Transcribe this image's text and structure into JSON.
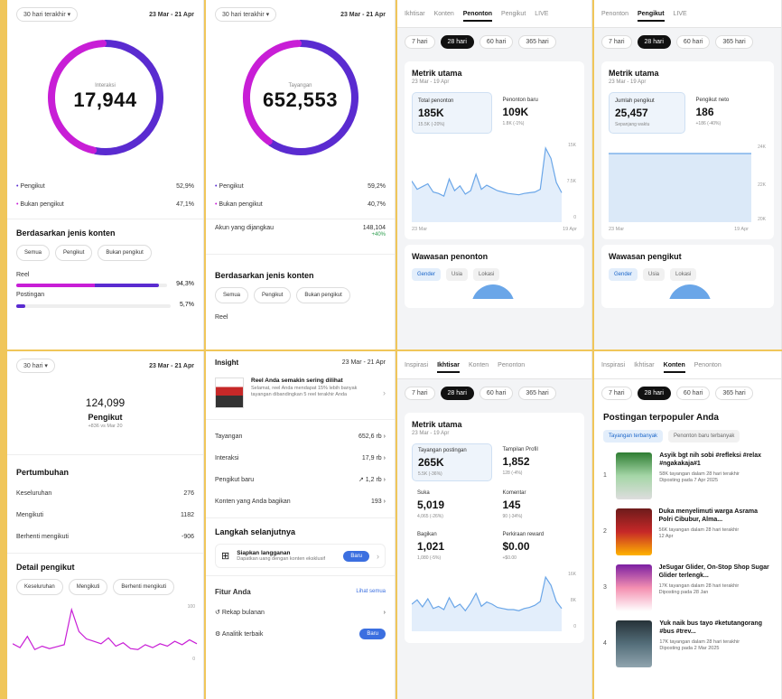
{
  "colors": {
    "magenta": "#c81ed6",
    "purple": "#5a2bd0",
    "accent_blue": "#3b6fe0",
    "line_blue": "#6aa6e8"
  },
  "p1": {
    "range": "30 hari terakhir",
    "dates": "23 Mar - 21 Apr",
    "donut_label": "Interaksi",
    "donut_value": "17,944",
    "follower_share": 0.529,
    "rows": [
      {
        "label": "Pengikut",
        "value": "52,9%"
      },
      {
        "label": "Bukan pengikut",
        "value": "47,1%"
      }
    ],
    "section": "Berdasarkan jenis konten",
    "chips": [
      "Semua",
      "Pengikut",
      "Bukan pengikut"
    ],
    "reel_label": "Reel",
    "reel_value": "94,3%",
    "reel_pct": 94.3,
    "post_label": "Postingan",
    "post_value": "5,7%",
    "post_pct": 5.7
  },
  "p2": {
    "range": "30 hari terakhir",
    "dates": "23 Mar - 21 Apr",
    "donut_label": "Tayangan",
    "donut_value": "652,553",
    "follower_share": 0.592,
    "rows": [
      {
        "label": "Pengikut",
        "value": "59,2%"
      },
      {
        "label": "Bukan pengikut",
        "value": "40,7%"
      }
    ],
    "reached_label": "Akun yang dijangkau",
    "reached_value": "148,104",
    "reached_change": "+40%",
    "section": "Berdasarkan jenis konten",
    "chips": [
      "Semua",
      "Pengikut",
      "Bukan pengikut"
    ],
    "reel_label": "Reel"
  },
  "p3": {
    "tabs": [
      "Ikhtisar",
      "Konten",
      "Penonton",
      "Pengikut",
      "LIVE"
    ],
    "active_tab": "Penonton",
    "pills": [
      "7 hari",
      "28 hari",
      "60 hari",
      "365 hari"
    ],
    "active_pill": "28 hari",
    "title": "Metrik utama",
    "sub": "23 Mar - 19 Apr",
    "metrics": [
      {
        "label": "Total penonton",
        "value": "185K",
        "change": "15.5K (-20%)"
      },
      {
        "label": "Penonton baru",
        "value": "109K",
        "change": "1.8K (-1%)"
      }
    ],
    "x_labels": [
      "23 Mar",
      "19 Apr"
    ],
    "y_labels": [
      "15K",
      "7.5K",
      "0"
    ],
    "insight_title": "Wawasan penonton",
    "segments": [
      "Gender",
      "Usia",
      "Lokasi"
    ],
    "series": [
      52,
      40,
      44,
      48,
      36,
      34,
      30,
      55,
      38,
      45,
      33,
      38,
      62,
      40,
      46,
      42,
      38,
      36,
      34,
      33,
      32,
      34,
      35,
      36,
      40,
      100,
      85,
      50,
      35
    ]
  },
  "p4": {
    "tabs": [
      "Penonton",
      "Pengikut",
      "LIVE"
    ],
    "active_tab": "Pengikut",
    "pills": [
      "7 hari",
      "28 hari",
      "60 hari",
      "365 hari"
    ],
    "active_pill": "28 hari",
    "title": "Metrik utama",
    "sub": "23 Mar - 19 Apr",
    "metrics": [
      {
        "label": "Jumlah pengikut",
        "value": "25,457",
        "change": "Sepanjang waktu"
      },
      {
        "label": "Pengikut neto",
        "value": "186",
        "change": "+186 (-40%)"
      }
    ],
    "x_labels": [
      "23 Mar",
      "19 Apr"
    ],
    "y_labels": [
      "24K",
      "22K",
      "20K"
    ],
    "insight_title": "Wawasan pengikut",
    "segments": [
      "Gender",
      "Usia",
      "Lokasi"
    ]
  },
  "p5": {
    "range": "30 hari",
    "dates": "23 Mar - 21 Apr",
    "followers": "124,099",
    "followers_label": "Pengikut",
    "followers_change": "+836 vs Mar 20",
    "growth_title": "Pertumbuhan",
    "growth_rows": [
      {
        "label": "Keseluruhan",
        "value": "276"
      },
      {
        "label": "Mengikuti",
        "value": "1182"
      },
      {
        "label": "Berhenti mengikuti",
        "value": "-906"
      }
    ],
    "detail_title": "Detail pengikut",
    "detail_chips": [
      "Keseluruhan",
      "Mengikuti",
      "Berhenti mengikuti"
    ],
    "y_labels": [
      "100",
      "0"
    ],
    "series": [
      30,
      22,
      45,
      18,
      25,
      20,
      24,
      28,
      100,
      55,
      40,
      35,
      30,
      42,
      25,
      32,
      20,
      18,
      28,
      22,
      30,
      25,
      35,
      28,
      38,
      30
    ]
  },
  "p6": {
    "title": "Insight",
    "dates": "23 Mar - 21 Apr",
    "tip_title": "Reel Anda semakin sering dilihat",
    "tip_body": "Selamat, reel Anda mendapat 15% lebih banyak tayangan dibandingkan 5 reel terakhir Anda",
    "rows": [
      {
        "label": "Tayangan",
        "value": "652,6 rb"
      },
      {
        "label": "Interaksi",
        "value": "17,9 rb"
      },
      {
        "label": "Pengikut baru",
        "value": "1,2 rb"
      },
      {
        "label": "Konten yang Anda bagikan",
        "value": "193"
      }
    ],
    "next_title": "Langkah selanjutnya",
    "next_item_title": "Siapkan langganan",
    "next_item_body": "Dapatkan uang dengan konten eksklusif",
    "next_btn": "Baru",
    "tools_title": "Fitur Anda",
    "tools_link": "Lihat semua",
    "tools": [
      "Rekap bulanan",
      "Analitik terbaik"
    ],
    "tools_btn": "Baru"
  },
  "p7": {
    "tabs": [
      "Inspirasi",
      "Ikhtisar",
      "Konten",
      "Penonton"
    ],
    "active_tab": "Ikhtisar",
    "pills": [
      "7 hari",
      "28 hari",
      "60 hari",
      "365 hari"
    ],
    "active_pill": "28 hari",
    "title": "Metrik utama",
    "sub": "23 Mar - 19 Apr",
    "metrics": [
      {
        "label": "Tayangan postingan",
        "value": "265K",
        "change": "5.5K (-36%)"
      },
      {
        "label": "Tampilan Profil",
        "value": "1,852",
        "change": "128 (-4%)"
      },
      {
        "label": "Suka",
        "value": "5,019",
        "change": "4,065 (-26%)"
      },
      {
        "label": "Komentar",
        "value": "145",
        "change": "90 (-34%)"
      },
      {
        "label": "Bagikan",
        "value": "1,021",
        "change": "1,080 (-5%)"
      },
      {
        "label": "Perkiraan reward",
        "value": "$0.00",
        "change": "+$0.00"
      }
    ],
    "y_labels": [
      "16K",
      "8K",
      "0"
    ],
    "series": [
      40,
      48,
      35,
      50,
      32,
      36,
      30,
      52,
      34,
      40,
      28,
      42,
      60,
      36,
      44,
      40,
      34,
      32,
      30,
      30,
      28,
      32,
      34,
      38,
      45,
      90,
      75,
      45,
      32
    ]
  },
  "p8": {
    "tabs": [
      "Inspirasi",
      "Ikhtisar",
      "Konten",
      "Penonton"
    ],
    "active_tab": "Konten",
    "pills": [
      "7 hari",
      "28 hari",
      "60 hari",
      "365 hari"
    ],
    "active_pill": "28 hari",
    "title": "Postingan terpopuler Anda",
    "segments": [
      "Tayangan terbanyak",
      "Penonton baru terbanyak"
    ],
    "posts": [
      {
        "num": "1",
        "title": "Asyik bgt nih sobi #refleksi #relax #ngakakaja#1",
        "views": "58K tayangan dalam 28 hari terakhir",
        "date": "Diposting pada 7 Apr 2025"
      },
      {
        "num": "2",
        "title": "Duka menyelimuti warga Asrama Polri Cibubur, Alma...",
        "views": "56K tayangan dalam 28 hari terakhir",
        "date": "12 Apr"
      },
      {
        "num": "3",
        "title": "JeSugar Glider, On-Stop Shop Sugar Glider terlengk...",
        "views": "17K tayangan dalam 28 hari terakhir",
        "date": "Diposting pada 28 Jan"
      },
      {
        "num": "4",
        "title": "Yuk naik bus tayo #ketutangorang #bus #trev...",
        "views": "17K tayangan dalam 28 hari terakhir",
        "date": "Diposting pada 2 Mar 2025"
      }
    ]
  }
}
